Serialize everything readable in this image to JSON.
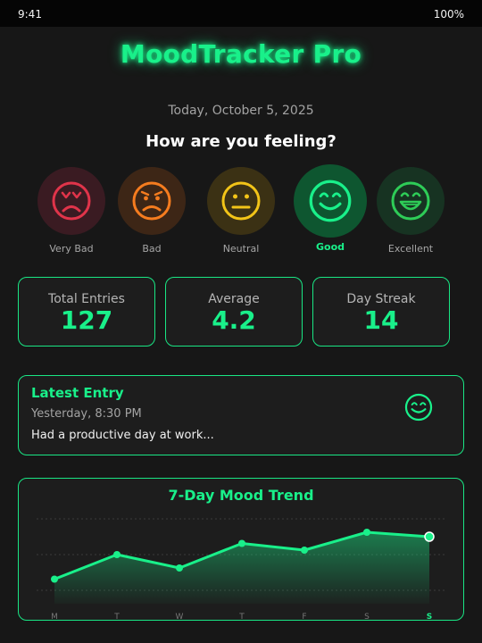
{
  "status_bar": {
    "time": "9:41",
    "battery": "100%"
  },
  "app": {
    "title": "MoodTracker Pro",
    "date": "Today, October 5, 2025",
    "question": "How are you feeling?"
  },
  "moods": [
    {
      "label": "Very Bad",
      "icon": "very-sad-face-icon",
      "color": "#e0344a",
      "selected": false
    },
    {
      "label": "Bad",
      "icon": "sad-face-icon",
      "color": "#f57c1f",
      "selected": false
    },
    {
      "label": "Neutral",
      "icon": "neutral-face-icon",
      "color": "#f2c418",
      "selected": false
    },
    {
      "label": "Good",
      "icon": "smile-face-icon",
      "color": "#19f08a",
      "selected": true
    },
    {
      "label": "Excellent",
      "icon": "grin-face-icon",
      "color": "#2ecc57",
      "selected": false
    }
  ],
  "stats": [
    {
      "label": "Total Entries",
      "value": "127"
    },
    {
      "label": "Average",
      "value": "4.2"
    },
    {
      "label": "Day Streak",
      "value": "14"
    }
  ],
  "latest_entry": {
    "title": "Latest Entry",
    "time": "Yesterday, 8:30 PM",
    "text": "Had a productive day at work...",
    "icon": "smile-face-icon"
  },
  "colors": {
    "accent": "#19f08a",
    "background": "#171717",
    "card": "#1d1d1d"
  },
  "chart_data": {
    "type": "area",
    "title": "7-Day Mood Trend",
    "categories": [
      "M",
      "T",
      "W",
      "T",
      "F",
      "S",
      "S"
    ],
    "values": [
      2.1,
      3.2,
      2.6,
      3.7,
      3.4,
      4.2,
      4.0
    ],
    "highlighted_index": 6,
    "ylim": [
      1,
      5
    ],
    "grid": true
  }
}
